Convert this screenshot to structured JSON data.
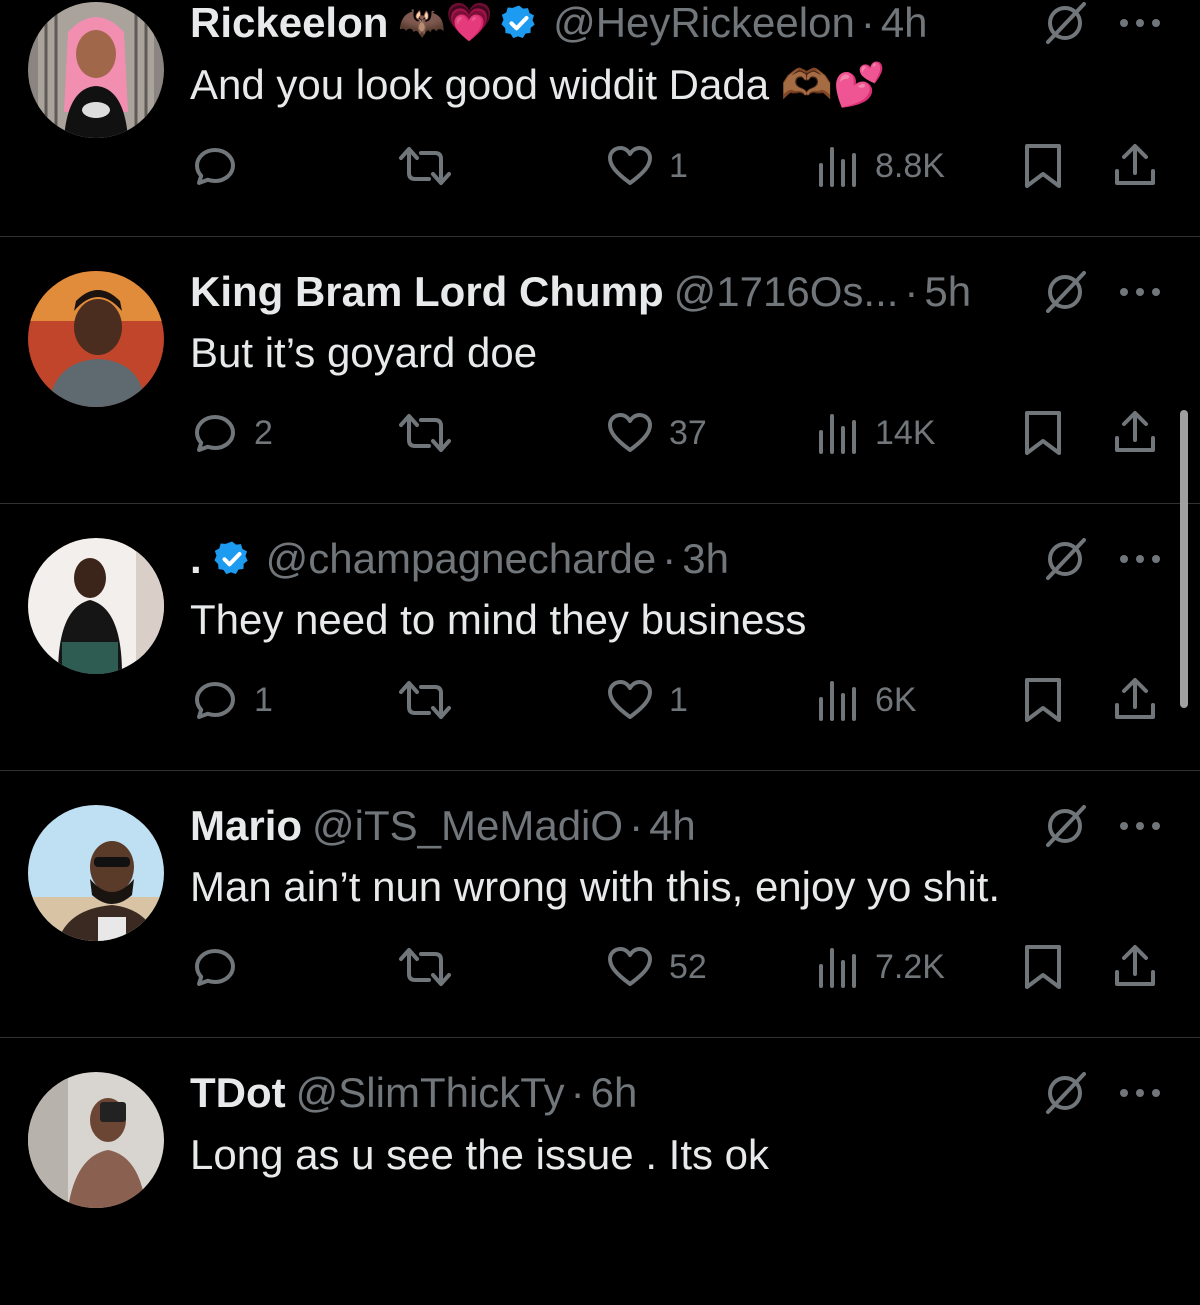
{
  "tweets": [
    {
      "display_name": "Rickeelon",
      "name_emojis": "🦇💗",
      "verified": true,
      "handle": "@HeyRickeelon",
      "time": "4h",
      "text": "And you look good widdit Dada 🫶🏾💕",
      "counts": {
        "reply": "",
        "retweet": "",
        "like": "1",
        "views": "8.8K"
      }
    },
    {
      "display_name": "King Bram Lord Chump",
      "name_emojis": "",
      "verified": false,
      "handle": "@1716Os...",
      "time": "5h",
      "text": "But it’s goyard doe",
      "counts": {
        "reply": "2",
        "retweet": "",
        "like": "37",
        "views": "14K"
      }
    },
    {
      "display_name": ".",
      "name_emojis": "",
      "verified": true,
      "handle": "@champagnecharde",
      "time": "3h",
      "text": "They need to mind they business",
      "counts": {
        "reply": "1",
        "retweet": "",
        "like": "1",
        "views": "6K"
      }
    },
    {
      "display_name": "Mario",
      "name_emojis": "",
      "verified": false,
      "handle": "@iTS_MeMadiO",
      "time": "4h",
      "text": "Man ain’t nun wrong with this, enjoy yo shit.",
      "counts": {
        "reply": "",
        "retweet": "",
        "like": "52",
        "views": "7.2K"
      }
    },
    {
      "display_name": "TDot",
      "name_emojis": "",
      "verified": false,
      "handle": "@SlimThickTy",
      "time": "6h",
      "text": "Long as u see the issue . Its ok",
      "counts": {
        "reply": "",
        "retweet": "",
        "like": "",
        "views": ""
      }
    }
  ],
  "separator": "·",
  "icons": {
    "reply": "reply-icon",
    "retweet": "retweet-icon",
    "like": "heart-icon",
    "views": "views-icon",
    "bookmark": "bookmark-icon",
    "share": "share-icon",
    "grok": "grok-icon",
    "more": "more-icon",
    "verified": "verified-badge-icon"
  },
  "colors": {
    "background": "#000000",
    "text": "#e7e9ea",
    "muted": "#71767b",
    "verified": "#1d9bf0",
    "divider": "#2f3336"
  }
}
